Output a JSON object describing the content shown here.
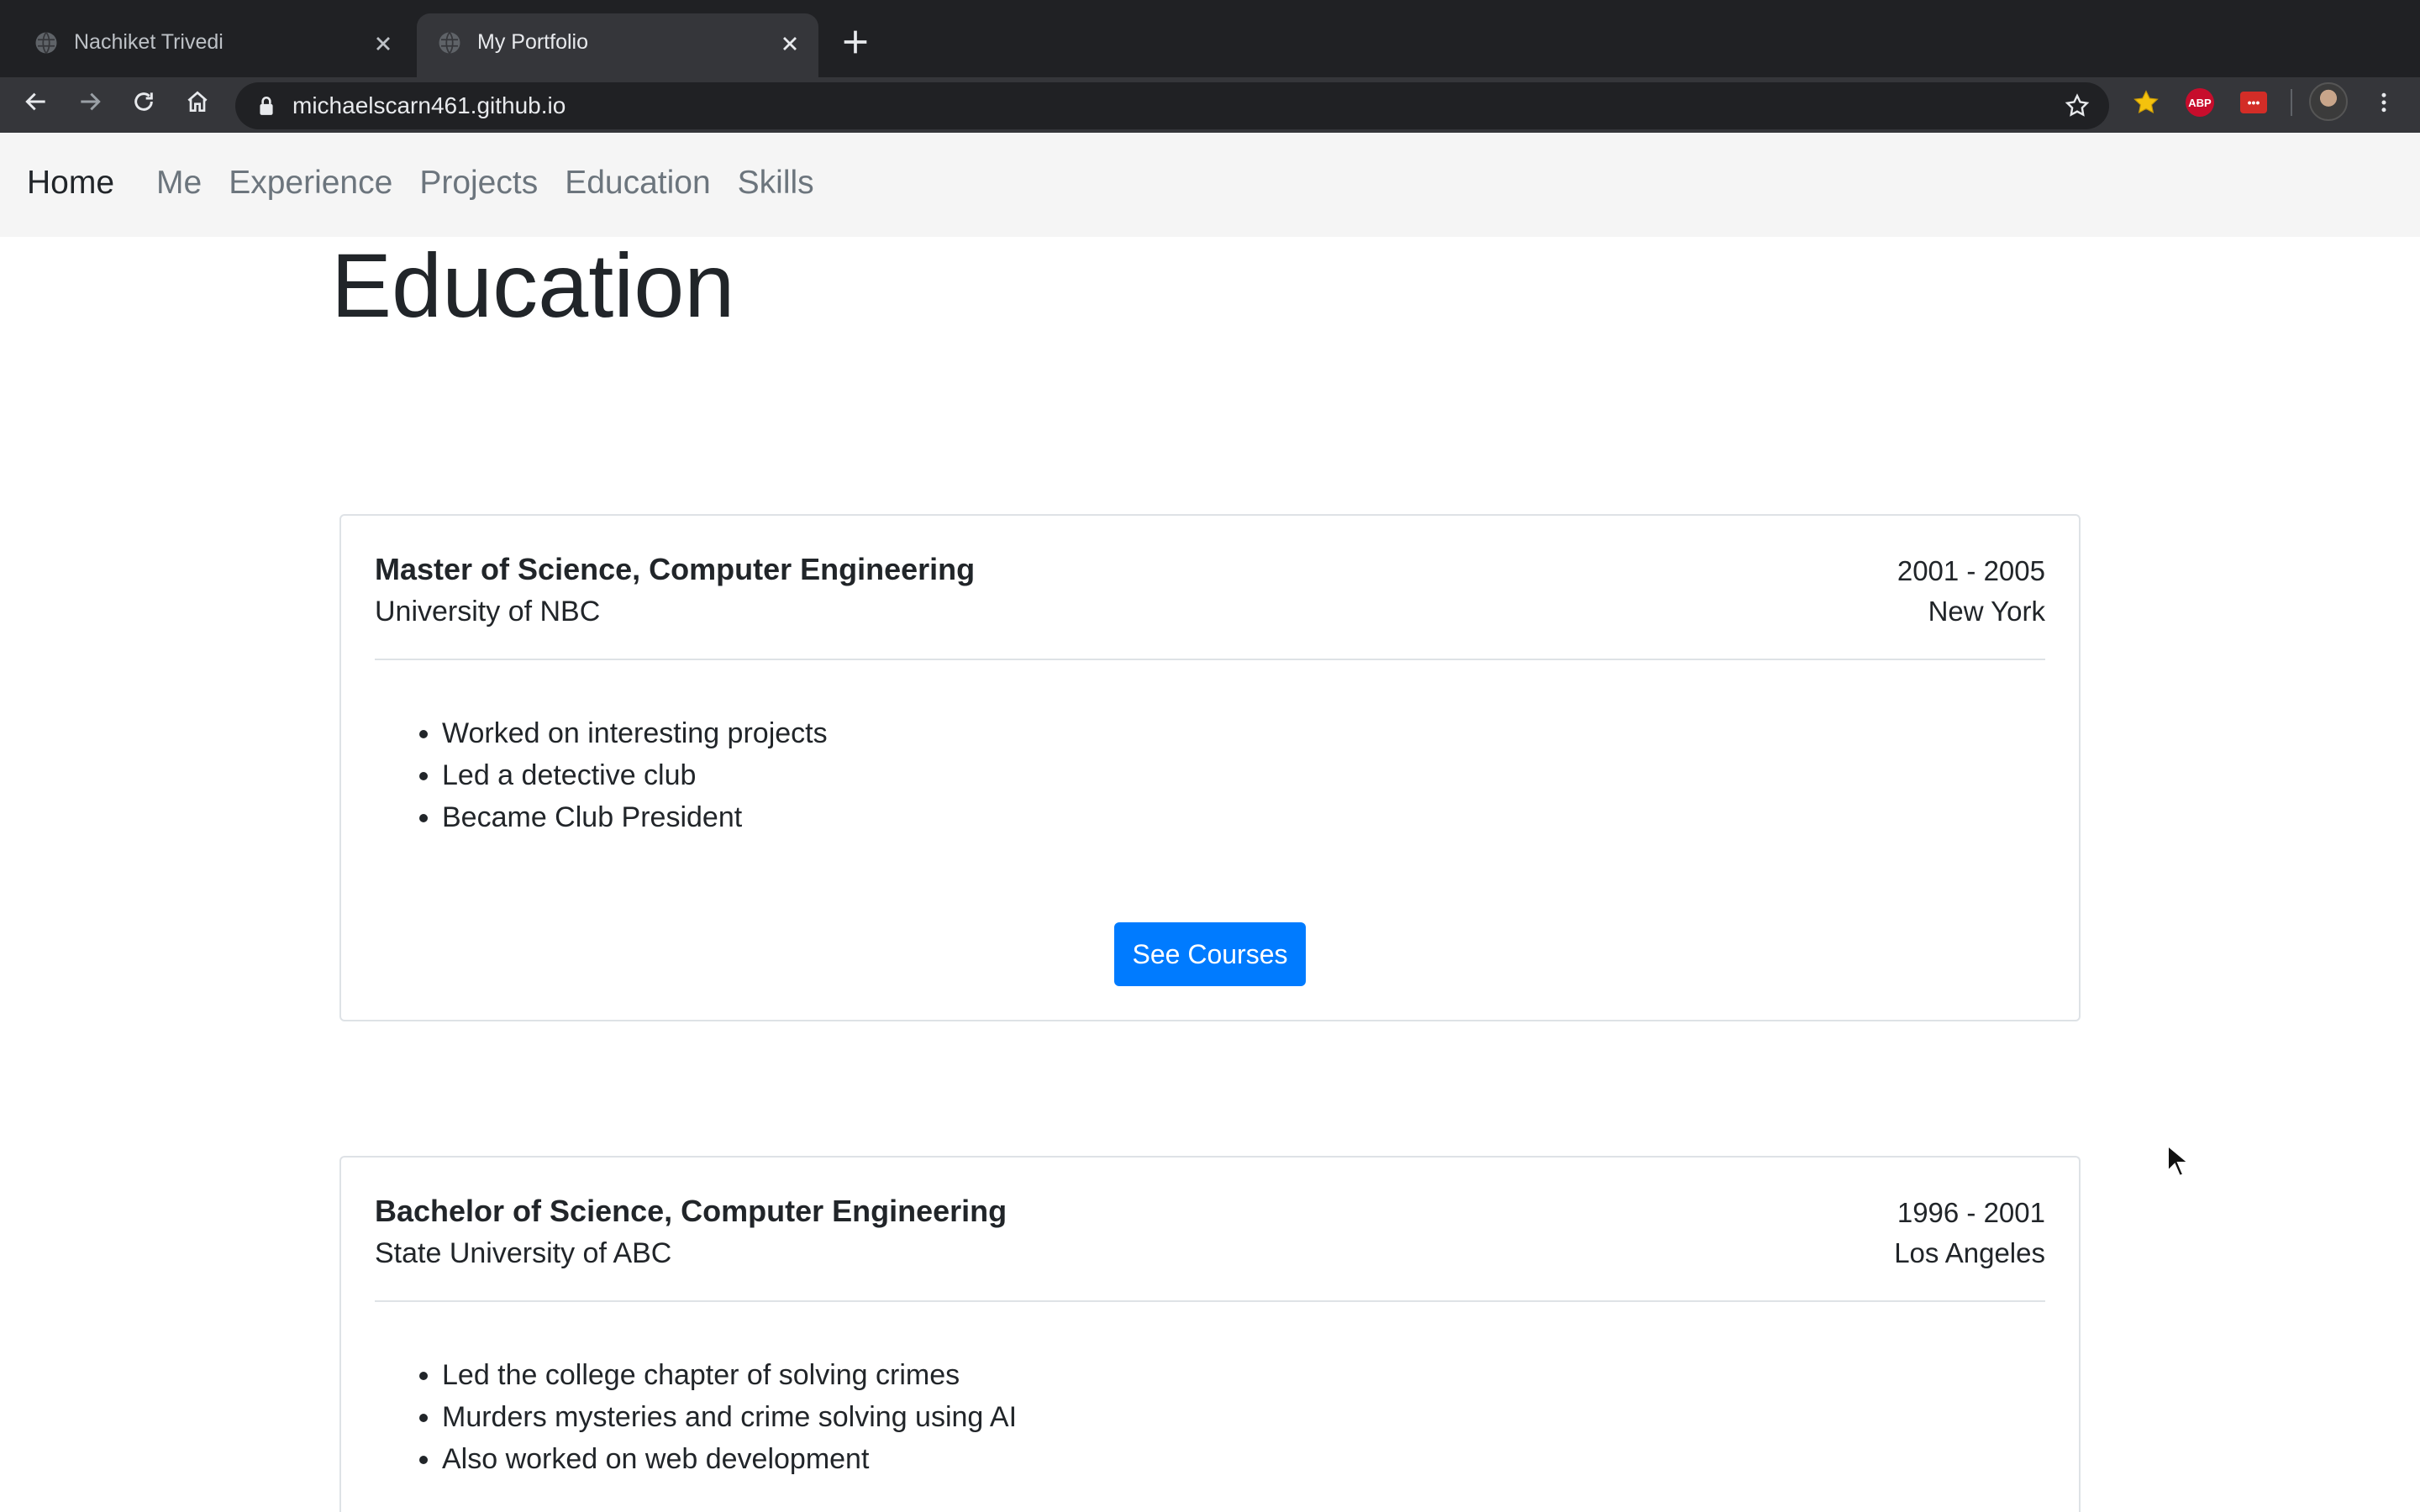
{
  "browser": {
    "tabs": [
      {
        "title": "Nachiket Trivedi",
        "active": false
      },
      {
        "title": "My Portfolio",
        "active": true
      }
    ],
    "url": "michaelscarn461.github.io",
    "extensions": {
      "abp_label": "ABP",
      "lastpass_label": "•••"
    },
    "colors": {
      "tabbar": "#202124",
      "toolbar": "#35363a"
    }
  },
  "navbar": {
    "brand": "Home",
    "links": [
      "Me",
      "Experience",
      "Projects",
      "Education",
      "Skills"
    ]
  },
  "section": {
    "title": "Education"
  },
  "education": [
    {
      "degree": "Master of Science, Computer Engineering",
      "school": "University of NBC",
      "years": "2001 - 2005",
      "location": "New York",
      "bullets": [
        "Worked on interesting projects",
        "Led a detective club",
        "Became Club President"
      ],
      "button": "See Courses"
    },
    {
      "degree": "Bachelor of Science, Computer Engineering",
      "school": "State University of ABC",
      "years": "1996 - 2001",
      "location": "Los Angeles",
      "bullets": [
        "Led the college chapter of solving crimes",
        "Murders mysteries and crime solving using AI",
        "Also worked on web development"
      ]
    }
  ],
  "accent_color": "#007bff"
}
